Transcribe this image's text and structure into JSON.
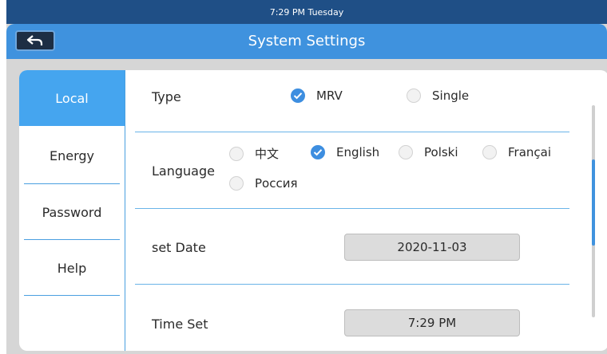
{
  "status_bar": {
    "text": "7:29 PM Tuesday"
  },
  "header": {
    "title": "System Settings"
  },
  "sidebar": {
    "items": [
      {
        "label": "Local",
        "active": true
      },
      {
        "label": "Energy"
      },
      {
        "label": "Password"
      },
      {
        "label": "Help"
      }
    ]
  },
  "type_row": {
    "label": "Type",
    "options": [
      {
        "label": "MRV",
        "checked": true
      },
      {
        "label": "Single",
        "checked": false
      }
    ]
  },
  "language_row": {
    "label": "Language",
    "options": [
      {
        "label": "中文",
        "checked": false
      },
      {
        "label": "English",
        "checked": true
      },
      {
        "label": "Polski",
        "checked": false
      },
      {
        "label": "Françai",
        "checked": false
      },
      {
        "label": "Россия",
        "checked": false
      }
    ]
  },
  "date_row": {
    "label": "set Date",
    "value": "2020-11-03"
  },
  "time_row": {
    "label": "Time Set",
    "value": "7:29 PM"
  },
  "colors": {
    "accent": "#3f92de",
    "status_bar": "#1f4f86",
    "active_tab": "#45a5ef"
  },
  "icons": {
    "back": "back-arrow-icon",
    "check": "check-icon"
  }
}
